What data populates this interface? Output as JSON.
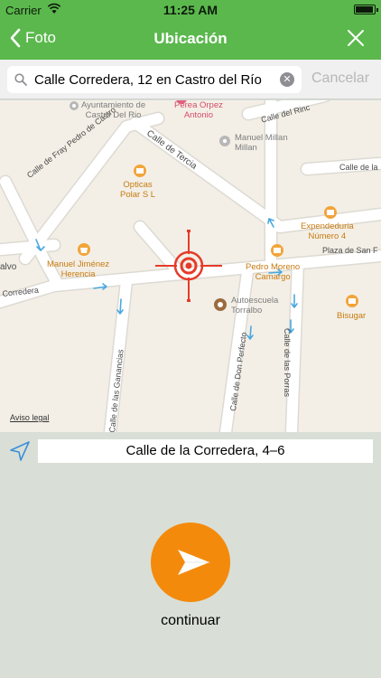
{
  "status": {
    "carrier": "Carrier",
    "time": "11:25 AM",
    "battery_level": 0.95
  },
  "nav": {
    "back_label": "Foto",
    "title": "Ubicación",
    "back_icon": "chevron-left-icon",
    "close_icon": "close-icon"
  },
  "search": {
    "value": "Calle Corredera, 12 en Castro del Río",
    "cancel_label": "Cancelar"
  },
  "map": {
    "streets": {
      "fray": "Calle de Fray Pedro de Castro",
      "tercia": "Calle de Tercia",
      "rinc": "Calle del Rinc",
      "la": "Calle de la",
      "plaza": "Plaza de San F",
      "corredera": "Corredera",
      "ganancias": "Calle de las Ganancias",
      "perfecto": "Calle de Don Perfecto",
      "porras": "Calle de las Porras",
      "alvo": "alvo"
    },
    "pois": {
      "ayuntamiento": "Ayuntamiento de\nCastro Del Rio",
      "perea": "Perea Orpez\nAntonio",
      "manuel_millan": "Manuel Millan\nMillan",
      "opticas": "Opticas\nPolar S L",
      "expendeduria": "Expendeduria\nNúmero 4",
      "manuel_jimenez": "Manuel Jiménez\nHerencia",
      "pedro": "Pedro Moreno\nCamargo",
      "autoescuela": "Autoescuela\nTorralbo",
      "bisugar": "Bisugar"
    },
    "legal": "Aviso legal"
  },
  "address": {
    "text": "Calle de la Corredera, 4–6"
  },
  "continue": {
    "label": "continuar"
  },
  "colors": {
    "nav_green": "#5bb84d",
    "accent_orange": "#f48a0c",
    "target_red": "#e53b2a",
    "poi_orange": "#c77a10"
  }
}
